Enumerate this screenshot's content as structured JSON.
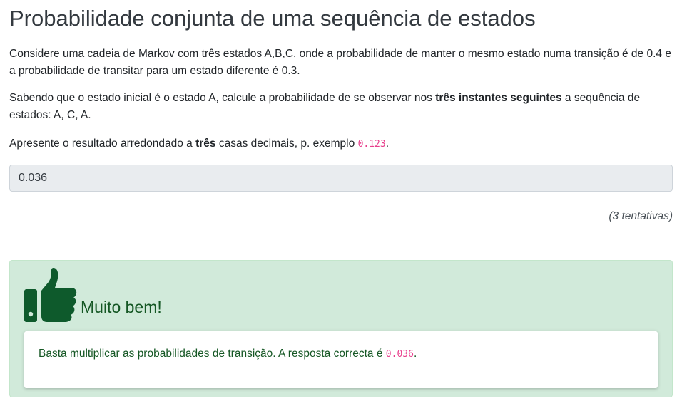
{
  "title": "Probabilidade conjunta de uma sequência de estados",
  "question": {
    "p1": "Considere uma cadeia de Markov com três estados A,B,C, onde a probabilidade de manter o mesmo estado numa transição é de 0.4 e a probabilidade de transitar para um estado diferente é 0.3.",
    "p2_before": "Sabendo que o estado inicial é o estado A, calcule a probabilidade de se observar nos ",
    "p2_bold": "três instantes seguintes",
    "p2_after": " a sequência de estados: A, C, A.",
    "p3_before": "Apresente o resultado arredondado a ",
    "p3_bold": "três",
    "p3_middle": " casas decimais, p. exemplo ",
    "p3_code": "0.123",
    "p3_after": "."
  },
  "answer": {
    "value": "0.036"
  },
  "attempts": "(3 tentativas)",
  "feedback": {
    "label": "Muito bem!",
    "text_before": "Basta multiplicar as probabilidades de transição. A resposta correcta é ",
    "code": "0.036",
    "text_after": ".",
    "icon": "thumbs-up-icon",
    "colors": {
      "background": "#d1eada",
      "text": "#155724",
      "icon": "#0e5a2c",
      "code": "#e83e8c"
    }
  }
}
